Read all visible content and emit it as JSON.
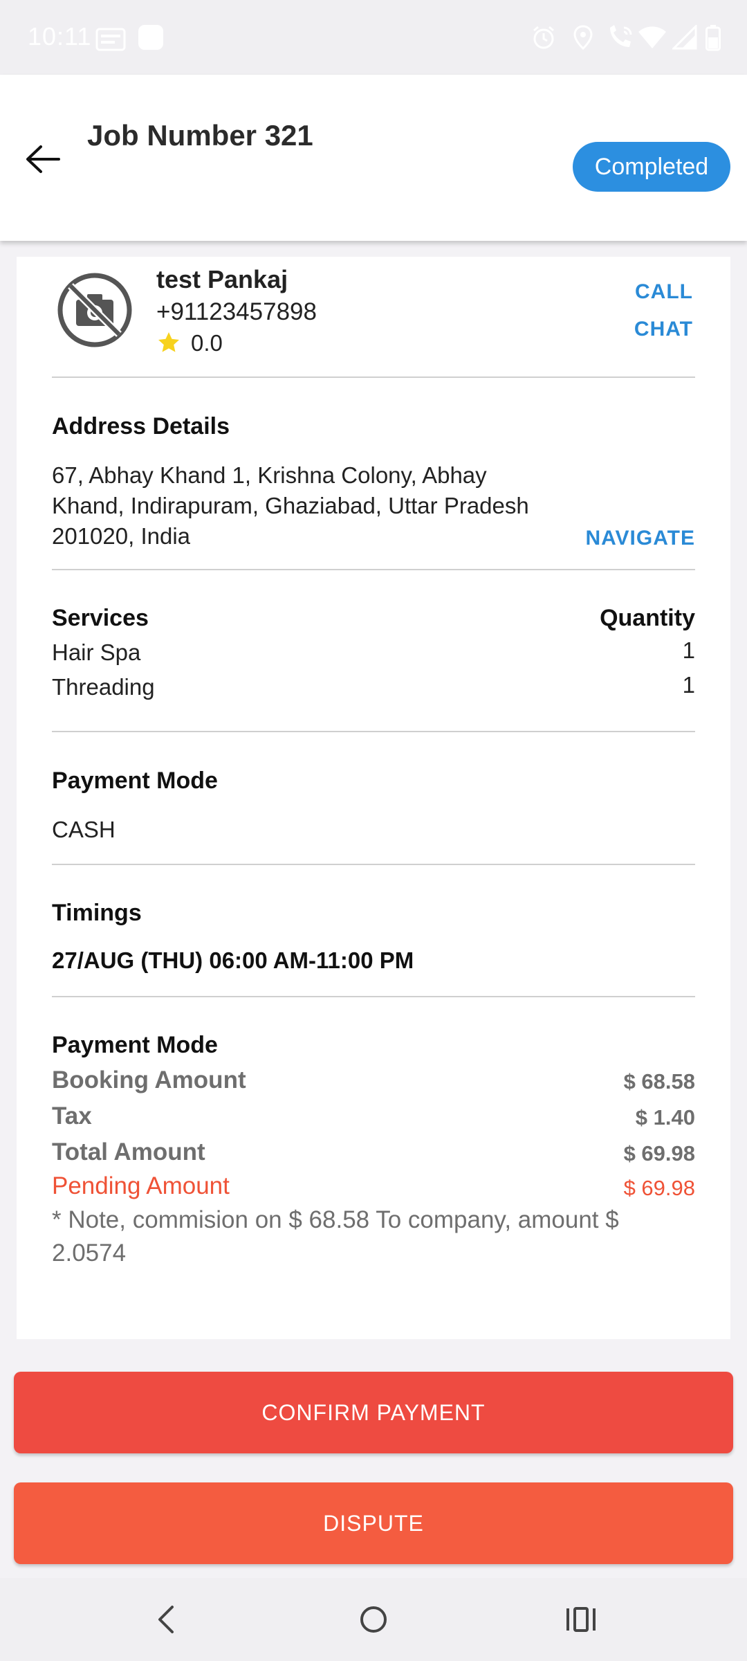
{
  "status_bar": {
    "time": "10:11",
    "icons": [
      "data-speed-icon",
      "app-notification-icon",
      "alarm-icon",
      "location-icon",
      "wifi-calling-icon",
      "wifi-icon",
      "signal-icon",
      "battery-icon"
    ]
  },
  "header": {
    "title": "Job Number 321",
    "status_badge": "Completed",
    "badge_color": "#2c8fe0"
  },
  "customer": {
    "name": "test Pankaj",
    "phone": "+91123457898",
    "rating": "0.0",
    "call_label": "CALL",
    "chat_label": "CHAT"
  },
  "address": {
    "title": "Address Details",
    "line1": "67, Abhay Khand 1, Krishna Colony, Abhay",
    "line2": "Khand, Indirapuram, Ghaziabad, Uttar Pradesh",
    "line3": "201020, India",
    "navigate_label": "NAVIGATE"
  },
  "services": {
    "title": "Services",
    "quantity_header": "Quantity",
    "items": [
      {
        "name": "Hair Spa",
        "quantity": "1"
      },
      {
        "name": "Threading",
        "quantity": "1"
      }
    ]
  },
  "payment_mode": {
    "title": "Payment Mode",
    "value": "CASH"
  },
  "timings": {
    "title": "Timings",
    "value": "27/AUG (THU) 06:00 AM-11:00 PM"
  },
  "billing": {
    "title": "Payment Mode",
    "booking_label": "Booking Amount",
    "booking_value": "$ 68.58",
    "tax_label": "Tax",
    "tax_value": "$ 1.40",
    "total_label": "Total Amount",
    "total_value": "$ 69.98",
    "pending_label": "Pending Amount",
    "pending_value": "$ 69.98",
    "note": "* Note, commision on $ 68.58 To company, amount $ 2.0574"
  },
  "actions": {
    "confirm_label": "CONFIRM PAYMENT",
    "dispute_label": "DISPUTE",
    "confirm_color": "#ee4b41",
    "dispute_color": "#f45c40"
  },
  "colors": {
    "link": "#2a8ad6",
    "pending": "#ef5236"
  }
}
